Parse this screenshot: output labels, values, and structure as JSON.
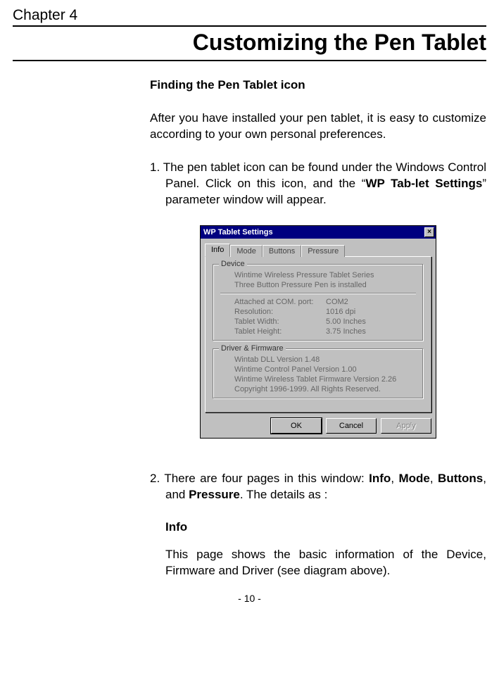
{
  "chapter_label": "Chapter 4",
  "page_title": "Customizing the Pen Tablet",
  "section_heading": "Finding the Pen Tablet icon",
  "intro_para": "After you have installed your pen tablet, it is easy to customize according to your own personal preferences.",
  "item1_prefix": "1. ",
  "item1_a": "The pen tablet icon can be found under the Windows Control Panel.    Click on this icon, and the “",
  "item1_bold": "WP Tab-let Settings",
  "item1_b": "” parameter window will appear.",
  "item2_prefix": "2. ",
  "item2_a": "There are four pages in this window: ",
  "item2_info": "Info",
  "item2_comma1": ", ",
  "item2_mode": "Mode",
  "item2_comma2": ", ",
  "item2_buttons": "Buttons",
  "item2_and": ", and ",
  "item2_pressure": "Pressure",
  "item2_tail": ".  The details as :",
  "info_heading": "Info",
  "info_para": "This page shows the basic information of the Device, Firmware and Driver (see diagram above).",
  "page_number": "- 10 -",
  "dialog": {
    "title": "WP Tablet Settings",
    "close": "×",
    "tabs": {
      "info": "Info",
      "mode": "Mode",
      "buttons": "Buttons",
      "pressure": "Pressure"
    },
    "device": {
      "legend": "Device",
      "l1": "Wintime Wireless Pressure Tablet Series",
      "l2": "Three Button Pressure Pen is installed",
      "com_label": "Attached at COM. port:",
      "com_val": "COM2",
      "res_label": "Resolution:",
      "res_val": "1016 dpi",
      "w_label": "Tablet Width:",
      "w_val": "5.00 Inches",
      "h_label": "Tablet Height:",
      "h_val": "3.75 Inches"
    },
    "driver": {
      "legend": "Driver & Firmware",
      "l1": "Wintab DLL Version 1.48",
      "l2": "Wintime Control Panel Version 1.00",
      "l3": "Wintime Wireless Tablet Firmware Version 2.26",
      "l4": "Copyright 1996-1999. All Rights Reserved."
    },
    "buttons": {
      "ok": "OK",
      "cancel": "Cancel",
      "apply": "Apply"
    }
  }
}
